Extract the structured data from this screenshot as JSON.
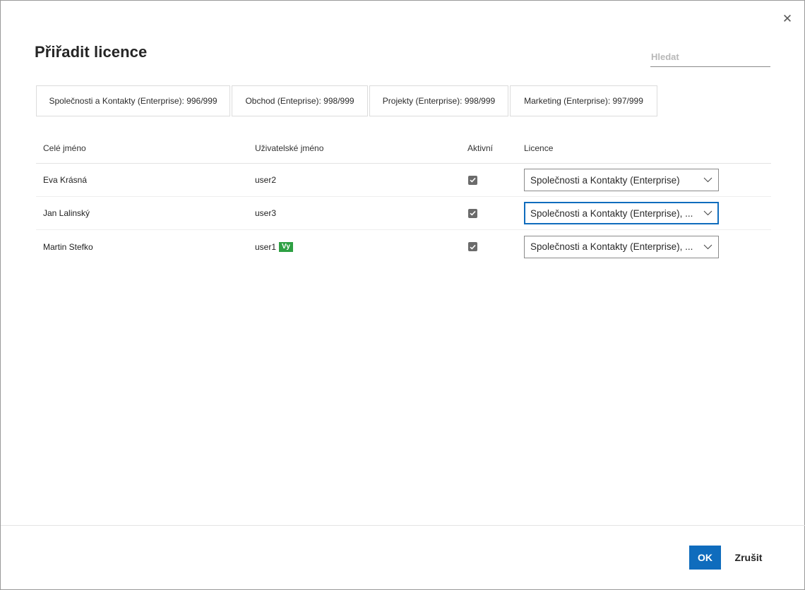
{
  "dialog": {
    "title": "Přiřadit licence",
    "close_icon": "close-icon",
    "search_placeholder": "Hledat"
  },
  "license_tabs": [
    {
      "label": "Společnosti a Kontakty (Enterprise): 996/999"
    },
    {
      "label": "Obchod (Enteprise): 998/999"
    },
    {
      "label": "Projekty (Enterprise): 998/999"
    },
    {
      "label": "Marketing (Enterprise): 997/999"
    }
  ],
  "table": {
    "headers": {
      "full_name": "Celé jméno",
      "username": "Uživatelské jméno",
      "active": "Aktivní",
      "license": "Licence"
    },
    "rows": [
      {
        "full_name": "Eva Krásná",
        "username": "user2",
        "badge": "",
        "active": true,
        "license": "Společnosti a Kontakty (Enterprise)"
      },
      {
        "full_name": "Jan Lalinský",
        "username": "user3",
        "badge": "",
        "active": true,
        "license": "Společnosti a Kontakty (Enterprise), ..."
      },
      {
        "full_name": "Martin Stefko",
        "username": "user1",
        "badge": "Vy",
        "active": true,
        "license": "Společnosti a Kontakty (Enterprise), ..."
      }
    ]
  },
  "footer": {
    "ok_label": "OK",
    "cancel_label": "Zrušit"
  },
  "colors": {
    "primary": "#0f6cbd",
    "badge": "#2ea043",
    "checkbox": "#6b6b6b"
  }
}
